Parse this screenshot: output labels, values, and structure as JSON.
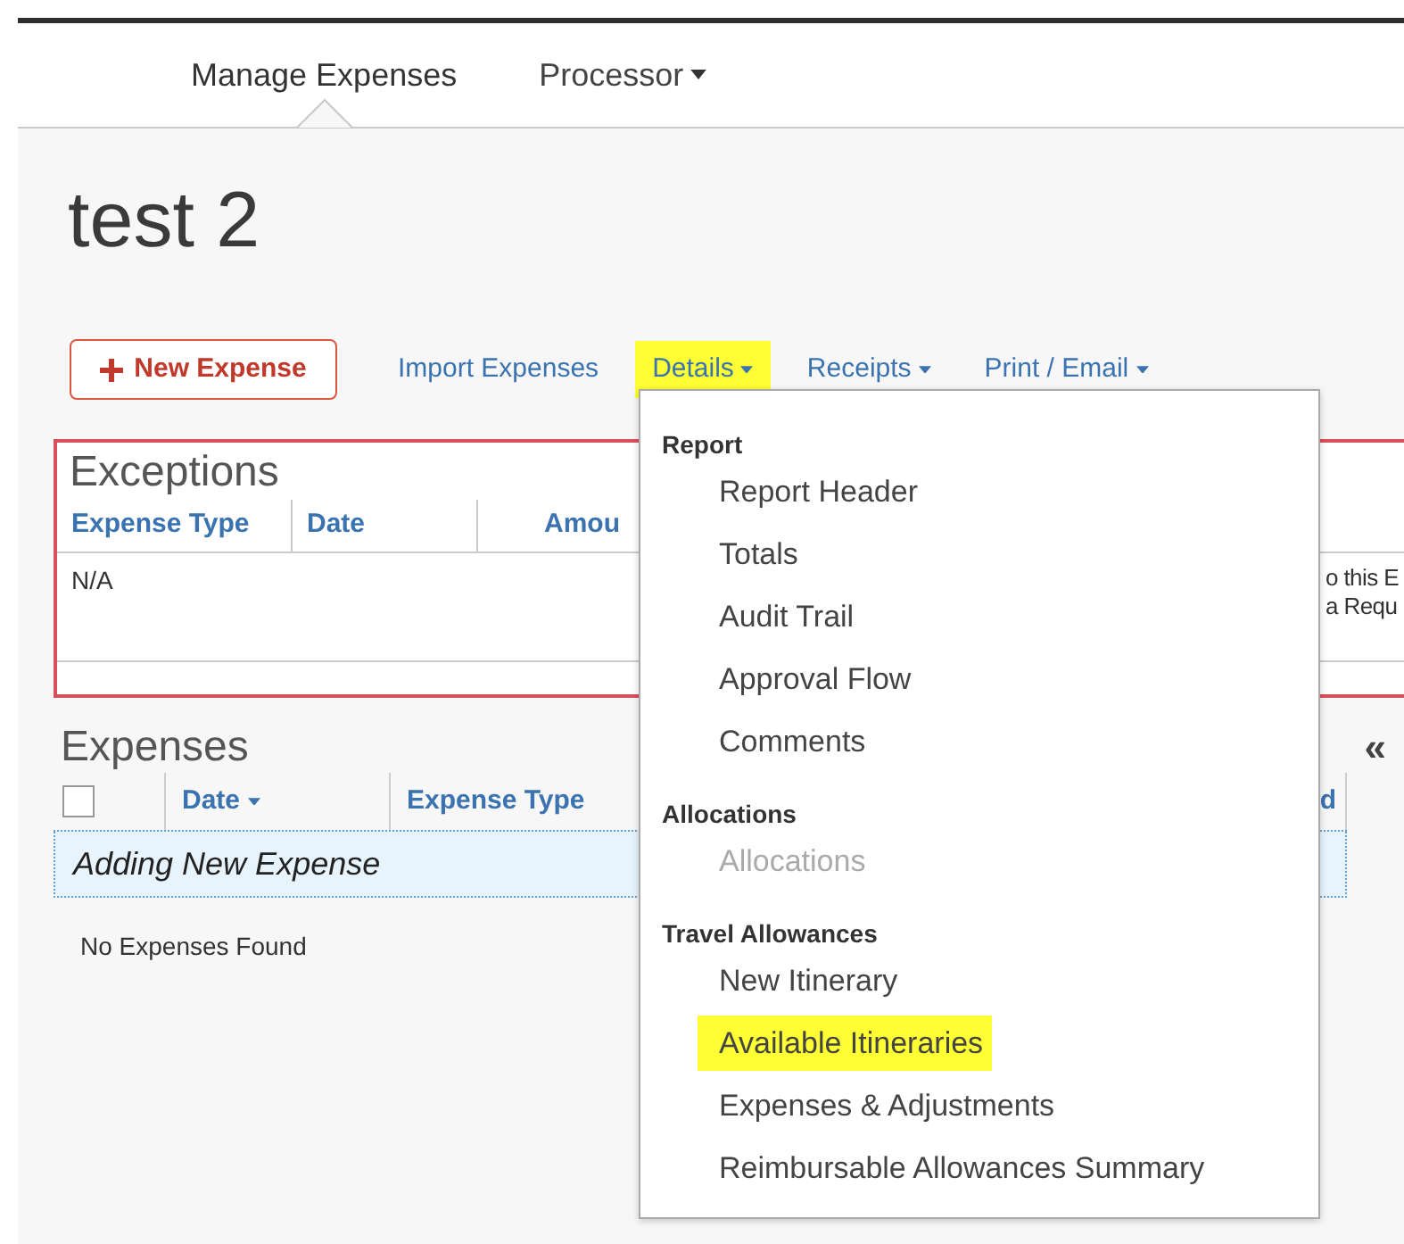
{
  "nav": [
    {
      "label": "Manage Expenses",
      "selected": true,
      "has_menu": false
    },
    {
      "label": "Processor",
      "selected": false,
      "has_menu": true
    }
  ],
  "page_title": "test 2",
  "toolbar": {
    "new_expense": "New Expense",
    "links": [
      {
        "label": "Import Expenses",
        "has_menu": false,
        "highlighted": false
      },
      {
        "label": "Details",
        "has_menu": true,
        "highlighted": true
      },
      {
        "label": "Receipts",
        "has_menu": true,
        "highlighted": false
      },
      {
        "label": "Print / Email",
        "has_menu": true,
        "highlighted": false
      }
    ]
  },
  "exceptions": {
    "title": "Exceptions",
    "columns": [
      "Expense Type",
      "Date",
      "Amou"
    ],
    "rows": [
      {
        "expense_type": "N/A"
      }
    ],
    "message_lines": [
      "o this E",
      "a Requ"
    ]
  },
  "expenses": {
    "title": "Expenses",
    "collapse": "«",
    "columns": [
      {
        "kind": "checkbox",
        "checked": false
      },
      {
        "kind": "sortable",
        "label": "Date"
      },
      {
        "kind": "text",
        "label": "Expense Type"
      },
      {
        "kind": "text",
        "label": "d"
      }
    ],
    "new_row": "Adding New Expense",
    "empty_message": "No Expenses Found"
  },
  "details_menu": {
    "sections": [
      {
        "heading": "Report",
        "items": [
          {
            "label": "Report Header",
            "disabled": false,
            "highlighted": false
          },
          {
            "label": "Totals",
            "disabled": false,
            "highlighted": false
          },
          {
            "label": "Audit Trail",
            "disabled": false,
            "highlighted": false
          },
          {
            "label": "Approval Flow",
            "disabled": false,
            "highlighted": false
          },
          {
            "label": "Comments",
            "disabled": false,
            "highlighted": false
          }
        ]
      },
      {
        "heading": "Allocations",
        "items": [
          {
            "label": "Allocations",
            "disabled": true,
            "highlighted": false
          }
        ]
      },
      {
        "heading": "Travel Allowances",
        "items": [
          {
            "label": "New Itinerary",
            "disabled": false,
            "highlighted": false
          },
          {
            "label": "Available Itineraries",
            "disabled": false,
            "highlighted": true
          },
          {
            "label": "Expenses & Adjustments",
            "disabled": false,
            "highlighted": false
          },
          {
            "label": "Reimbursable Allowances Summary",
            "disabled": false,
            "highlighted": false
          }
        ]
      }
    ]
  }
}
